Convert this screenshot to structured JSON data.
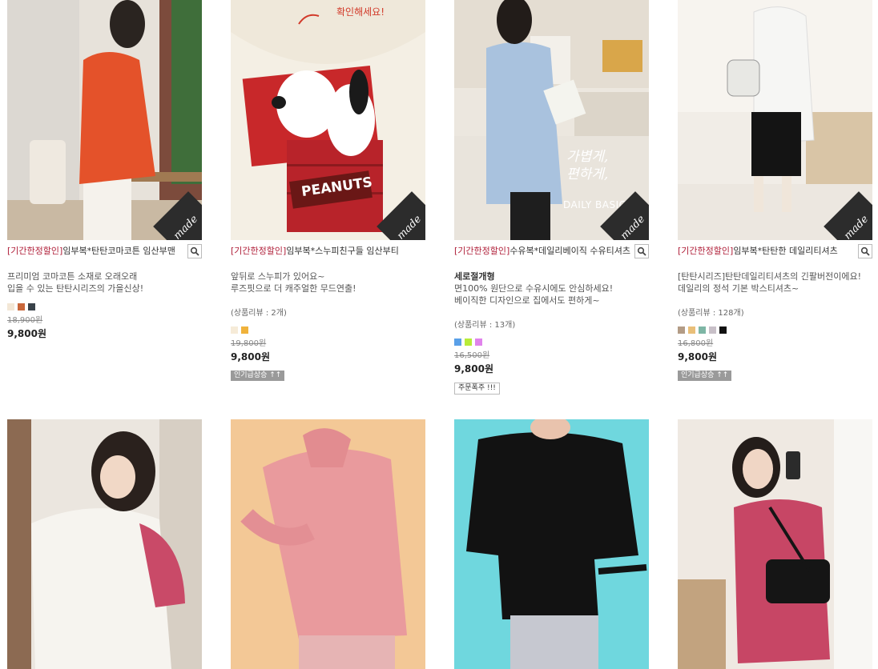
{
  "products": [
    {
      "title_prefix": "[기간한정할인]",
      "title_text": "임부복*탄탄코마코튼 임산부맨",
      "bold": "",
      "desc": [
        "프리미엄 코마코튼 소재로 오래오래",
        "입을 수 있는 탄탄시리즈의 가을신상!"
      ],
      "review": "",
      "colors": [
        "#f3e7d6",
        "#c9673a",
        "#39424a"
      ],
      "orig_price": "18,900원",
      "price": "9,800원",
      "badge": ""
    },
    {
      "title_prefix": "[기간한정할인]",
      "title_text": "임부복*스누피친구들 임산부티",
      "bold": "",
      "desc": [
        "앞뒤로 스누피가 있어요~",
        "루즈핏으로 더 캐주얼한 무드연출!"
      ],
      "review": "(상품리뷰 : 2개)",
      "colors": [
        "#f6ebd8",
        "#f0b23b"
      ],
      "orig_price": "19,800원",
      "price": "9,800원",
      "badge": "인기급상승 ↑↑"
    },
    {
      "title_prefix": "[기간한정할인]",
      "title_text": "수유복*데일리베이직 수유티셔츠",
      "bold": "세로절개형",
      "desc": [
        "면100% 원단으로 수유시에도 안심하세요!",
        "베이직한 디자인으로 집에서도 편하게~"
      ],
      "review": "(상품리뷰 : 13개)",
      "colors": [
        "#5aa0e8",
        "#b8ec3a",
        "#e083ec"
      ],
      "orig_price": "16,500원",
      "price": "9,800원",
      "badge": "주문폭주 !!!"
    },
    {
      "title_prefix": "[기간한정할인]",
      "title_text": "임부복*탄탄한 데일리티셔츠",
      "bold": "",
      "desc": [
        "[탄탄시리즈]탄탄데일리티셔츠의 긴팔버전이에요!",
        "데일리의 정석 기본 박스티셔츠~"
      ],
      "review": "(상품리뷰 : 128개)",
      "colors": [
        "#b39c86",
        "#e9bf79",
        "#7eb6a5",
        "#c8c0c8",
        "#111111"
      ],
      "orig_price": "16,800원",
      "price": "9,800원",
      "badge": "인기급상승 ↑↑"
    }
  ],
  "image_text": {
    "made": "made",
    "peanuts": "PEANUTS",
    "korean_note": "확인해세요!",
    "promo_line1": "가볍게,",
    "promo_line2": "편하게,",
    "promo_line3": "DAILY BASIC"
  }
}
